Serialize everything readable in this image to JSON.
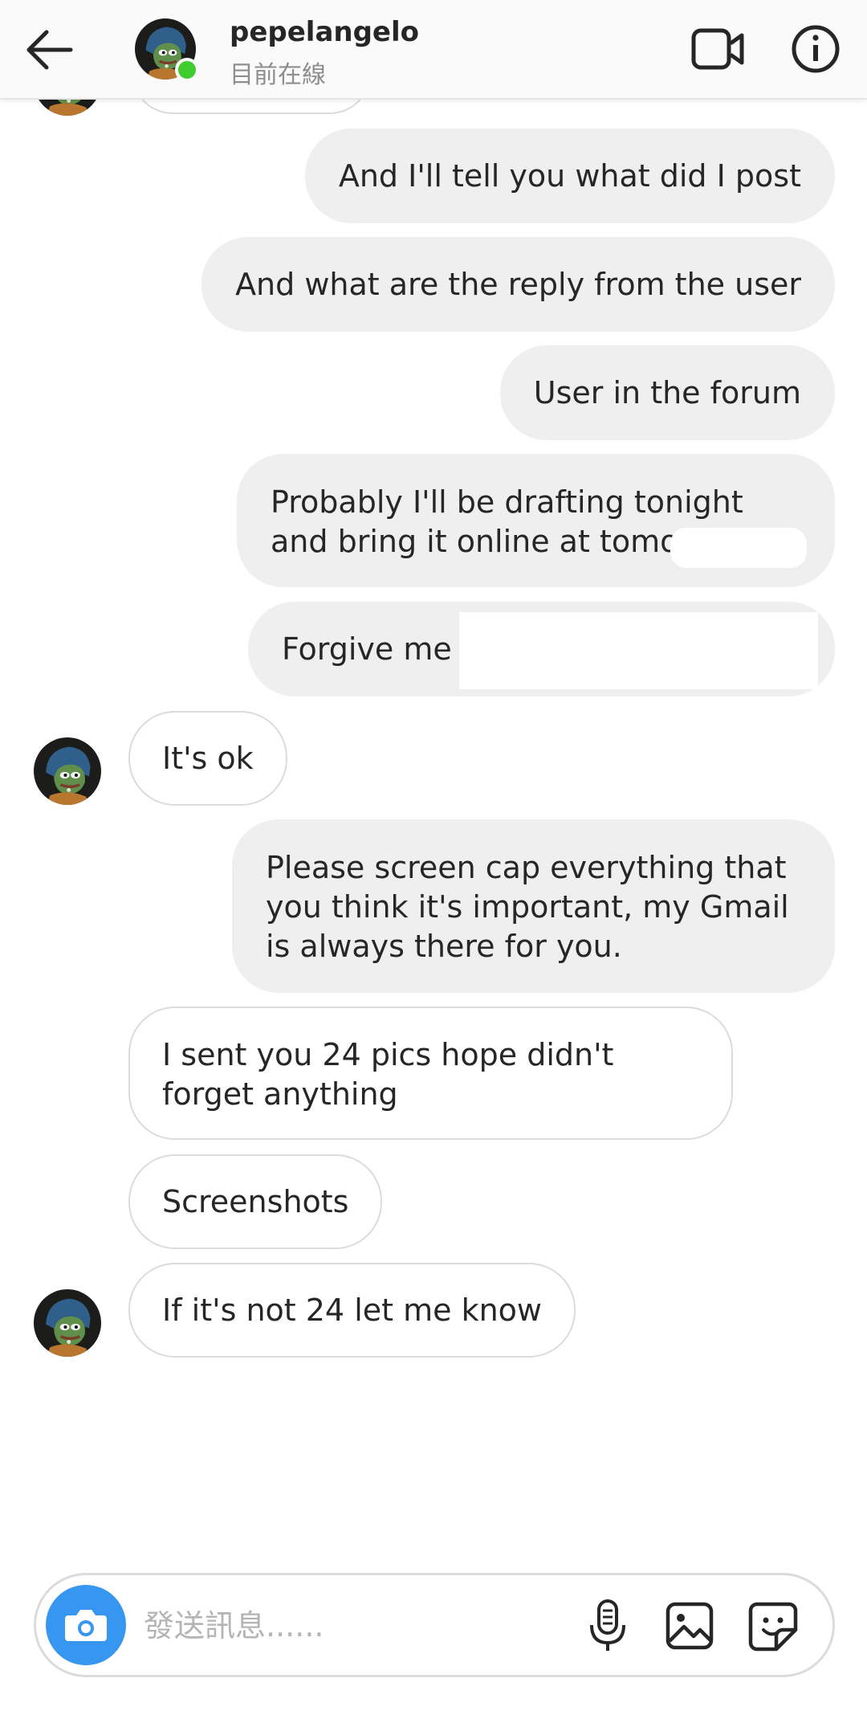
{
  "header": {
    "username": "pepelangelo",
    "status": "目前在線"
  },
  "icons": {
    "back": "back-arrow-icon",
    "video": "video-call-icon",
    "info": "info-icon",
    "camera": "camera-icon",
    "mic": "microphone-icon",
    "gallery": "gallery-icon",
    "sticker": "sticker-icon"
  },
  "colors": {
    "accent": "#3797f0",
    "online": "#3fcc2f",
    "outgoing_bubble": "#efefef",
    "incoming_border": "#dbdbdb"
  },
  "messages": [
    {
      "id": "m1",
      "direction": "outgoing",
      "text": "And I'll tell you what did I post"
    },
    {
      "id": "m2",
      "direction": "outgoing",
      "text": "And what are the reply from the user"
    },
    {
      "id": "m3",
      "direction": "outgoing",
      "text": "User in the forum"
    },
    {
      "id": "m4",
      "direction": "outgoing",
      "text": "Probably I'll be drafting tonight and bring it online at tomorrow"
    },
    {
      "id": "m5",
      "direction": "outgoing",
      "text": "Forgive me f"
    },
    {
      "id": "m6",
      "direction": "incoming",
      "text": "It's ok"
    },
    {
      "id": "m7",
      "direction": "outgoing",
      "text": "Please screen cap everything that you think it's important, my Gmail is always there for you."
    },
    {
      "id": "m8",
      "direction": "incoming",
      "text": "I sent you 24 pics hope didn't forget anything"
    },
    {
      "id": "m9",
      "direction": "incoming",
      "text": "Screenshots"
    },
    {
      "id": "m10",
      "direction": "incoming",
      "text": "If it's not 24 let me know"
    }
  ],
  "composer": {
    "placeholder": "發送訊息......"
  }
}
